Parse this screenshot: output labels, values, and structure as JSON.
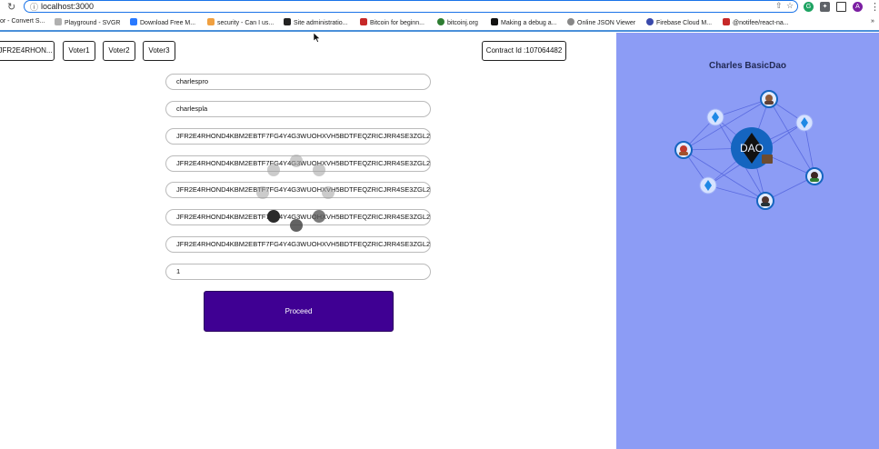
{
  "browser": {
    "url": "localhost:3000",
    "profile_initial": "A",
    "bookmarks": [
      "or - Convert S...",
      "Playground - SVGR",
      "Download Free M...",
      "security - Can I us...",
      "Site administratio...",
      "Bitcoin for beginn...",
      "bitcoinj.org",
      "Making a debug a...",
      "Online JSON Viewer",
      "Firebase Cloud M...",
      "@notifee/react-na..."
    ],
    "overflow": "»"
  },
  "app": {
    "account_buttons": [
      "JFR2E4RHON...",
      "Voter1",
      "Voter2",
      "Voter3"
    ],
    "contract_label": "Contract Id :107064482",
    "fields": [
      "charlespro",
      "charlespla",
      "JFR2E4RHOND4KBM2EBTF7FG4Y4G3WUOHXVH5BDTFEQZRICJRR4SE3ZGL2",
      "JFR2E4RHOND4KBM2EBTF7FG4Y4G3WUOHXVH5BDTFEQZRICJRR4SE3ZGL2",
      "JFR2E4RHOND4KBM2EBTF7FG4Y4G3WUOHXVH5BDTFEQZRICJRR4SE3ZGL2",
      "JFR2E4RHOND4KBM2EBTF7FG4Y4G3WUOHXVH5BDTFEQZRICJRR4SE3ZGL2",
      "JFR2E4RHOND4KBM2EBTF7FG4Y4G3WUOHXVH5BDTFEQZRICJRR4SE3ZGL2",
      "1"
    ],
    "proceed_label": "Proceed"
  },
  "panel": {
    "title": "Charles BasicDao",
    "center_label": "DAO",
    "bg_color": "#8c9cf5",
    "node_color": "#1565c0"
  },
  "colors": {
    "proceed_bg": "#3f0093",
    "accent": "#1a73e8"
  }
}
